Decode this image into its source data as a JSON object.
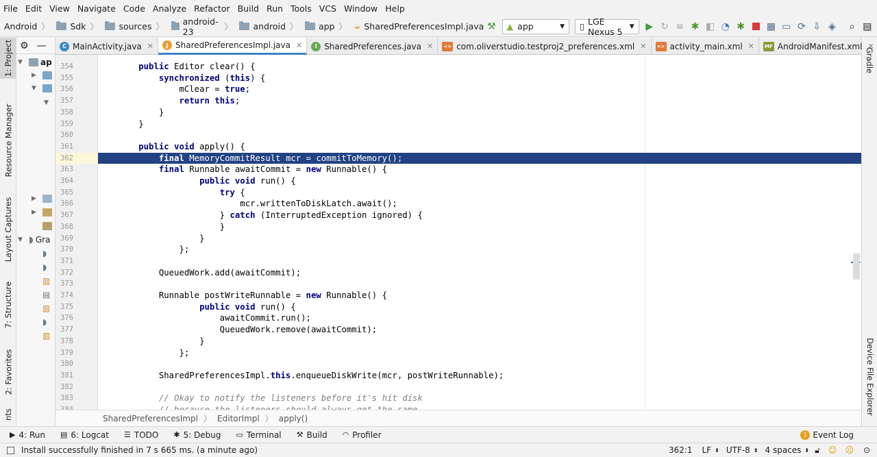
{
  "menu": [
    "File",
    "Edit",
    "View",
    "Navigate",
    "Code",
    "Analyze",
    "Refactor",
    "Build",
    "Run",
    "Tools",
    "VCS",
    "Window",
    "Help"
  ],
  "breadcrumb": [
    "Android",
    "Sdk",
    "sources",
    "android-23",
    "android",
    "app",
    "SharedPreferencesImpl.java"
  ],
  "run_config": "app",
  "device": "LGE Nexus 5",
  "left_tabs": [
    "1: Project",
    "Resource Manager",
    "Layout Captures",
    "7: Structure",
    "2: Favorites",
    "nts"
  ],
  "right_tabs": [
    "Gradle",
    "Device File Explorer"
  ],
  "project": {
    "root": "ap",
    "gradle_label": "Gra"
  },
  "tabs": [
    {
      "label": "MainActivity.java",
      "icon": "C",
      "color": "#3b8bc5"
    },
    {
      "label": "SharedPreferencesImpl.java",
      "icon": "J",
      "color": "#e8a033",
      "active": true
    },
    {
      "label": "SharedPreferences.java",
      "icon": "I",
      "color": "#69a85a"
    },
    {
      "label": "com.oliverstudio.testproj2_preferences.xml",
      "icon": "<>",
      "color": "#e0793a"
    },
    {
      "label": "activity_main.xml",
      "icon": "<>",
      "color": "#e0793a"
    },
    {
      "label": "AndroidManifest.xml",
      "icon": "MF",
      "color": "#8a9a3a"
    }
  ],
  "code": [
    {
      "n": "354",
      "t": "        <k>public</k> Editor clear() {"
    },
    {
      "n": "355",
      "t": "            <k>synchronized</k> (<k>this</k>) {"
    },
    {
      "n": "356",
      "t": "                mClear = <k>true</k>;"
    },
    {
      "n": "357",
      "t": "                <k>return</k> <k>this</k>;"
    },
    {
      "n": "358",
      "t": "            }"
    },
    {
      "n": "359",
      "t": "        }"
    },
    {
      "n": "360",
      "t": ""
    },
    {
      "n": "361",
      "t": "        <k>public</k> <k>void</k> apply() {"
    },
    {
      "n": "362",
      "t": "            <k>final</k> MemoryCommitResult mcr = commitToMemory();",
      "sel": true
    },
    {
      "n": "363",
      "t": "            <k>final</k> Runnable awaitCommit = <k>new</k> Runnable() {"
    },
    {
      "n": "364",
      "t": "                    <k>public</k> <k>void</k> run() {"
    },
    {
      "n": "365",
      "t": "                        <k>try</k> {"
    },
    {
      "n": "366",
      "t": "                            mcr.writtenToDiskLatch.await();"
    },
    {
      "n": "367",
      "t": "                        } <k>catch</k> (InterruptedException ignored) {"
    },
    {
      "n": "368",
      "t": "                        }"
    },
    {
      "n": "369",
      "t": "                    }"
    },
    {
      "n": "370",
      "t": "                };"
    },
    {
      "n": "371",
      "t": ""
    },
    {
      "n": "372",
      "t": "            QueuedWork.add(awaitCommit);"
    },
    {
      "n": "373",
      "t": ""
    },
    {
      "n": "374",
      "t": "            Runnable postWriteRunnable = <k>new</k> Runnable() {"
    },
    {
      "n": "375",
      "t": "                    <k>public</k> <k>void</k> run() {"
    },
    {
      "n": "376",
      "t": "                        awaitCommit.run();"
    },
    {
      "n": "377",
      "t": "                        QueuedWork.remove(awaitCommit);"
    },
    {
      "n": "378",
      "t": "                    }"
    },
    {
      "n": "379",
      "t": "                };"
    },
    {
      "n": "380",
      "t": ""
    },
    {
      "n": "381",
      "t": "            SharedPreferencesImpl.<k>this</k>.enqueueDiskWrite(mcr, postWriteRunnable);"
    },
    {
      "n": "382",
      "t": ""
    },
    {
      "n": "383",
      "t": "            <c>// Okay to notify the listeners before it's hit disk</c>"
    },
    {
      "n": "384",
      "t": "            <c>// because the listeners should always get the same</c>"
    }
  ],
  "editor_crumbs": [
    "SharedPreferencesImpl",
    "EditorImpl",
    "apply()"
  ],
  "tool_windows": [
    {
      "label": "4: Run",
      "glyph": "▶"
    },
    {
      "label": "6: Logcat",
      "glyph": "▤"
    },
    {
      "label": "TODO",
      "glyph": "☰"
    },
    {
      "label": "5: Debug",
      "glyph": "✱"
    },
    {
      "label": "Terminal",
      "glyph": "▭"
    },
    {
      "label": "Build",
      "glyph": "⚒"
    },
    {
      "label": "Profiler",
      "glyph": "◠"
    }
  ],
  "event_log": "Event Log",
  "event_count": "1",
  "status": {
    "message": "Install successfully finished in 7 s 665 ms. (a minute ago)",
    "position": "362:1",
    "line_sep": "LF",
    "encoding": "UTF-8",
    "indent": "4 spaces"
  }
}
